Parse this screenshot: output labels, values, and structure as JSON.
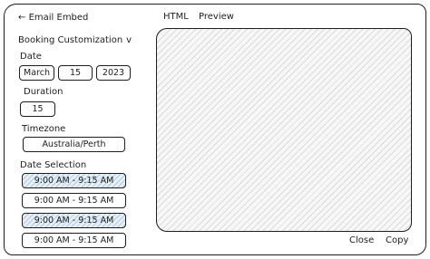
{
  "back": {
    "icon": "arrow-left-icon",
    "label": "Email Embed"
  },
  "tabs": [
    {
      "label": "HTML"
    },
    {
      "label": "Preview"
    }
  ],
  "section": {
    "title": "Booking Customization",
    "chevron_icon": "chevron-down-icon"
  },
  "date": {
    "label": "Date",
    "month": "March",
    "day": "15",
    "year": "2023"
  },
  "duration": {
    "label": "Duration",
    "value": "15"
  },
  "timezone": {
    "label": "Timezone",
    "value": "Australia/Perth"
  },
  "date_selection": {
    "label": "Date Selection",
    "slots": [
      {
        "time": "9:00 AM - 9:15 AM",
        "selected": true
      },
      {
        "time": "9:00 AM - 9:15 AM",
        "selected": false
      },
      {
        "time": "9:00 AM - 9:15 AM",
        "selected": true
      },
      {
        "time": "9:00 AM - 9:15 AM",
        "selected": false
      }
    ]
  },
  "footer": {
    "close_label": "Close",
    "copy_label": "Copy"
  },
  "colors": {
    "ink": "#1e1e1e",
    "selected_fill": "#e4eff8"
  }
}
